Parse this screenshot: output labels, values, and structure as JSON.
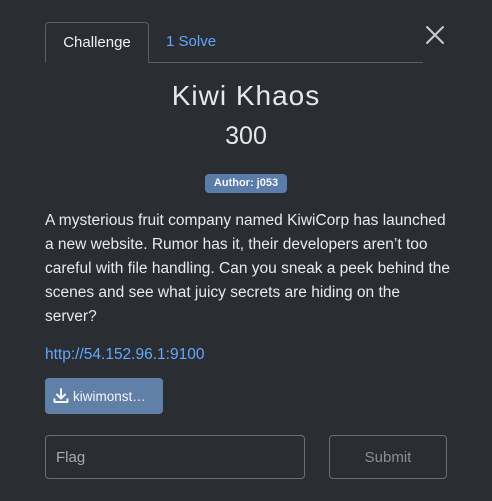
{
  "tabs": {
    "challenge_label": "Challenge",
    "solves_label": "1 Solve"
  },
  "challenge": {
    "name": "Kiwi Khaos",
    "points": "300",
    "author_badge": "Author: j053",
    "description": "A mysterious fruit company named KiwiCorp has launched a new website. Rumor has it, their developers aren’t too careful with file handling. Can you sneak a peek behind the scenes and see what juicy secrets are hiding on the server?",
    "link": "http://54.152.96.1:9100",
    "file_label": "kiwimonst…"
  },
  "form": {
    "flag_placeholder": "Flag",
    "flag_value": "",
    "submit_label": "Submit"
  },
  "icons": {
    "close": "close-icon",
    "download": "download-icon"
  },
  "colors": {
    "background": "#2a2d31",
    "link": "#62a8ff",
    "badge": "#5b7ca8",
    "file_button": "#6180a8"
  }
}
